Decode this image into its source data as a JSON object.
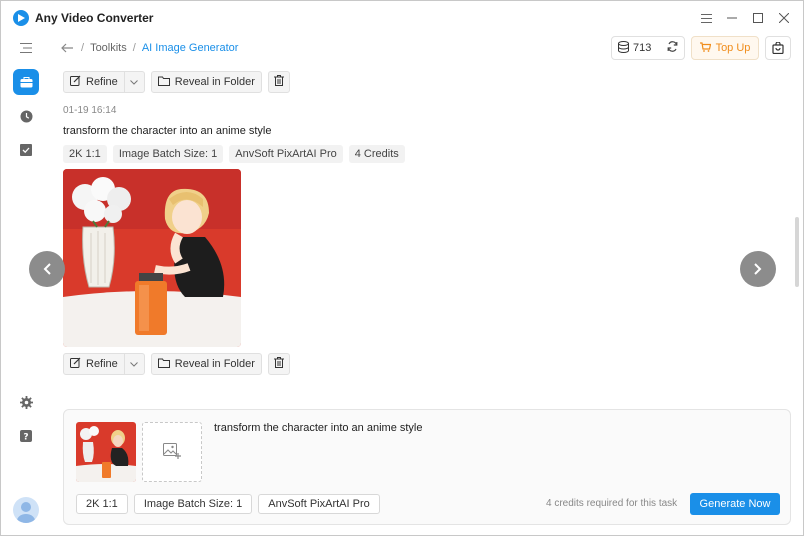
{
  "app": {
    "title": "Any Video Converter"
  },
  "window_controls": {
    "menu": "≡",
    "minimize": "–",
    "maximize": "□",
    "close": "✕"
  },
  "breadcrumb": {
    "parent": "Toolkits",
    "current": "AI Image Generator",
    "separator": "/"
  },
  "header": {
    "credits": "713",
    "topup_label": "Top Up"
  },
  "prev_item": {
    "refine_label": "Refine",
    "reveal_label": "Reveal in Folder"
  },
  "item": {
    "timestamp": "01-19 16:14",
    "prompt": "transform the character into an anime style",
    "tags": [
      "2K 1:1",
      "Image Batch Size: 1",
      "AnvSoft PixArtAI Pro",
      "4 Credits"
    ],
    "refine_label": "Refine",
    "reveal_label": "Reveal in Folder"
  },
  "input_panel": {
    "prompt": "transform the character into an anime style",
    "tags": [
      "2K 1:1",
      "Image Batch Size: 1",
      "AnvSoft PixArtAI Pro"
    ],
    "credits_note": "4 credits required for this task",
    "generate_label": "Generate Now"
  },
  "icons": {
    "sidebar": [
      "menu-icon",
      "toolbox-icon",
      "history-icon",
      "tasks-icon",
      "settings-icon",
      "help-icon",
      "avatar"
    ],
    "colors": {
      "accent": "#1a8fe8",
      "topup": "#f08c1a",
      "image_red": "#d93a2b"
    }
  }
}
